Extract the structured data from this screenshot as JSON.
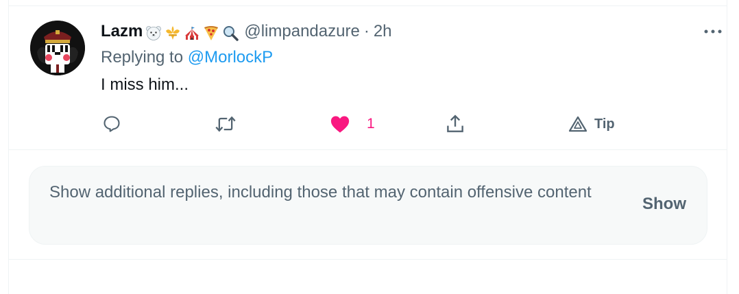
{
  "tweet": {
    "display_name": "Lazm",
    "name_emojis": [
      "polar-bear-icon",
      "fleur-de-lis-icon",
      "circus-tent-icon",
      "pizza-icon",
      "magnifier-icon"
    ],
    "handle": "@limpandazure",
    "separator": "·",
    "time": "2h",
    "replying_to_prefix": "Replying to",
    "replying_to_handle": "@MorlockP",
    "text": "I miss him...",
    "actions": {
      "reply_icon": "speech-bubble-icon",
      "retweet_icon": "retweet-icon",
      "like_icon": "heart-filled-icon",
      "like_count": "1",
      "share_icon": "share-upload-icon",
      "tip_icon": "tip-triangle-icon",
      "tip_label": "Tip"
    },
    "more_icon": "more-dots-icon"
  },
  "additional_replies": {
    "text": "Show additional replies, including those that may contain offensive content",
    "button_label": "Show"
  },
  "colors": {
    "link": "#1d9bf0",
    "like": "#f91880",
    "secondary_text": "#536471",
    "primary_text": "#0f1419"
  }
}
